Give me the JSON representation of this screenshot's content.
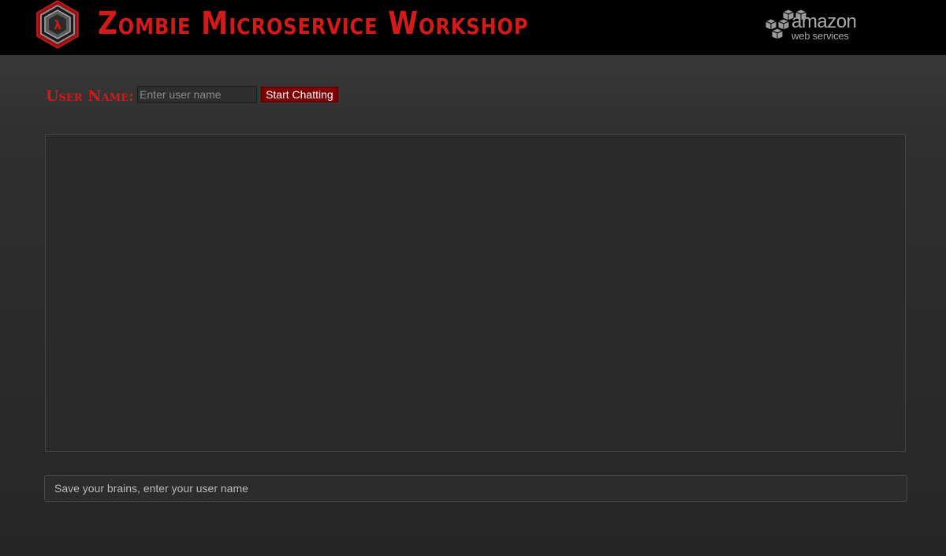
{
  "header": {
    "title": "Zombie Microservice Workshop",
    "logo_icon": "lambda-hexagon-icon",
    "aws_logo": {
      "icon": "aws-cubes-icon",
      "brand": "amazon",
      "subtitle": "web services"
    }
  },
  "user_form": {
    "label": "User Name:",
    "input_value": "",
    "input_placeholder": "Enter user name",
    "button_label": "Start Chatting"
  },
  "chat": {
    "messages": []
  },
  "message_box": {
    "value": "",
    "placeholder": "Save your brains, enter your user name"
  },
  "colors": {
    "accent_red": "#d21a1a",
    "button_red": "#7e0000",
    "header_bg": "#000000"
  }
}
